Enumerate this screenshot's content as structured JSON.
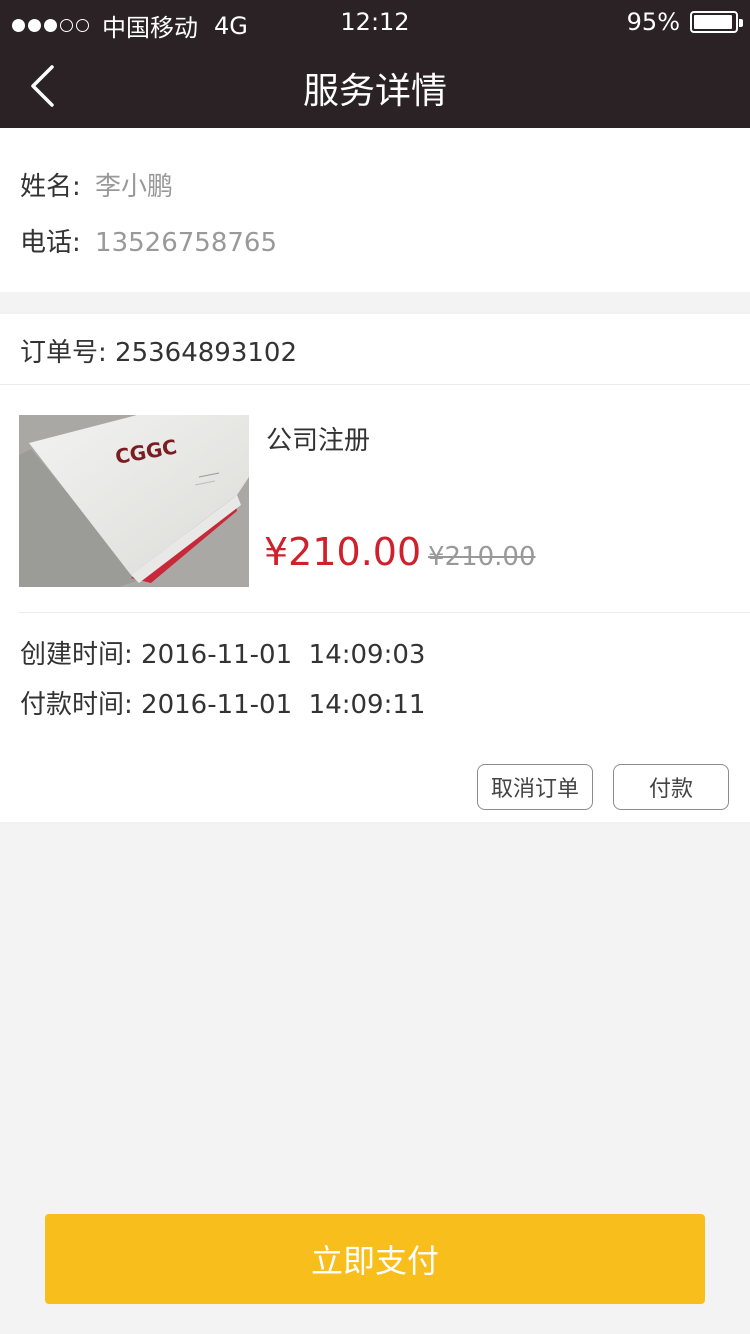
{
  "status_bar": {
    "carrier": "中国移动",
    "network": "4G",
    "time": "12:12",
    "battery_percent": "95%",
    "battery_level": 0.95,
    "signal_bars": 3,
    "signal_total": 5
  },
  "navbar": {
    "title": "服务详情",
    "back_icon": "chevron-left-icon"
  },
  "contact": {
    "name_label": "姓名:",
    "name_value": "李小鹏",
    "phone_label": "电话:",
    "phone_value": "13526758765"
  },
  "order": {
    "order_no_label": "订单号:",
    "order_no_value": "25364893102",
    "product": {
      "name": "公司注册",
      "price": "¥210.00",
      "original_price": "¥210.00",
      "image_logo_text": "CGGC"
    },
    "created_label": "创建时间:",
    "created_value": "2016-11-01  14:09:03",
    "paid_label": "付款时间:",
    "paid_value": "2016-11-01  14:09:11",
    "cancel_label": "取消订单",
    "pay_label": "付款"
  },
  "footer": {
    "pay_now_label": "立即支付"
  },
  "colors": {
    "header_bg": "#2a2224",
    "price_red": "#d0202b",
    "pay_yellow": "#f8be1c",
    "background": "#f3f3f3"
  }
}
